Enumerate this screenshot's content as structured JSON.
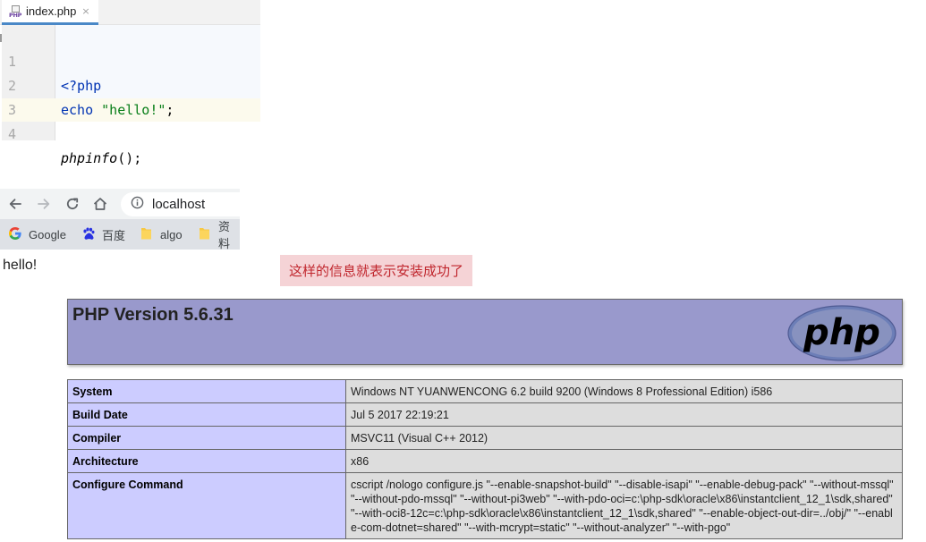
{
  "editor": {
    "tab_label": "index.php",
    "tab_icon_text": "PHP",
    "tab_close": "×",
    "lines": [
      {
        "number": "1",
        "text": "<?php"
      },
      {
        "number": "2",
        "text_kw": "echo ",
        "text_str": "\"hello!\"",
        "text_end": ";"
      },
      {
        "number": "3",
        "text": ""
      },
      {
        "number": "4",
        "text_fn": "phpinfo",
        "text_end": "();"
      }
    ]
  },
  "browser": {
    "url": "localhost",
    "icons": [
      "back-arrow-icon",
      "forward-arrow-icon",
      "reload-icon",
      "home-icon",
      "info-icon"
    ],
    "bookmarks": [
      {
        "label": "Google",
        "icon": "google-icon"
      },
      {
        "label": "百度",
        "icon": "baidu-paw-icon"
      },
      {
        "label": "algo",
        "icon": "folder-icon"
      },
      {
        "label": "资料",
        "icon": "folder-icon"
      }
    ]
  },
  "page": {
    "hello_text": "hello!",
    "annotation": "这样的信息就表示安装成功了"
  },
  "phpinfo": {
    "title": "PHP Version 5.6.31",
    "logo_text": "php",
    "rows": [
      {
        "key": "System",
        "value": "Windows NT YUANWENCONG 6.2 build 9200 (Windows 8 Professional Edition) i586"
      },
      {
        "key": "Build Date",
        "value": "Jul 5 2017 22:19:21"
      },
      {
        "key": "Compiler",
        "value": "MSVC11 (Visual C++ 2012)"
      },
      {
        "key": "Architecture",
        "value": "x86"
      },
      {
        "key": "Configure Command",
        "value": "cscript /nologo configure.js \"--enable-snapshot-build\" \"--disable-isapi\" \"--enable-debug-pack\" \"--without-mssql\" \"--without-pdo-mssql\" \"--without-pi3web\" \"--with-pdo-oci=c:\\php-sdk\\oracle\\x86\\instantclient_12_1\\sdk,shared\" \"--with-oci8-12c=c:\\php-sdk\\oracle\\x86\\instantclient_12_1\\sdk,shared\" \"--enable-object-out-dir=../obj/\" \"--enable-com-dotnet=shared\" \"--with-mcrypt=static\" \"--without-analyzer\" \"--with-pgo\""
      }
    ]
  },
  "colors": {
    "header_bg": "#9999cc",
    "key_bg": "#ccccff",
    "value_bg": "#dddddd",
    "annotation_bg": "#f5d3d6",
    "annotation_text": "#c0262d"
  }
}
